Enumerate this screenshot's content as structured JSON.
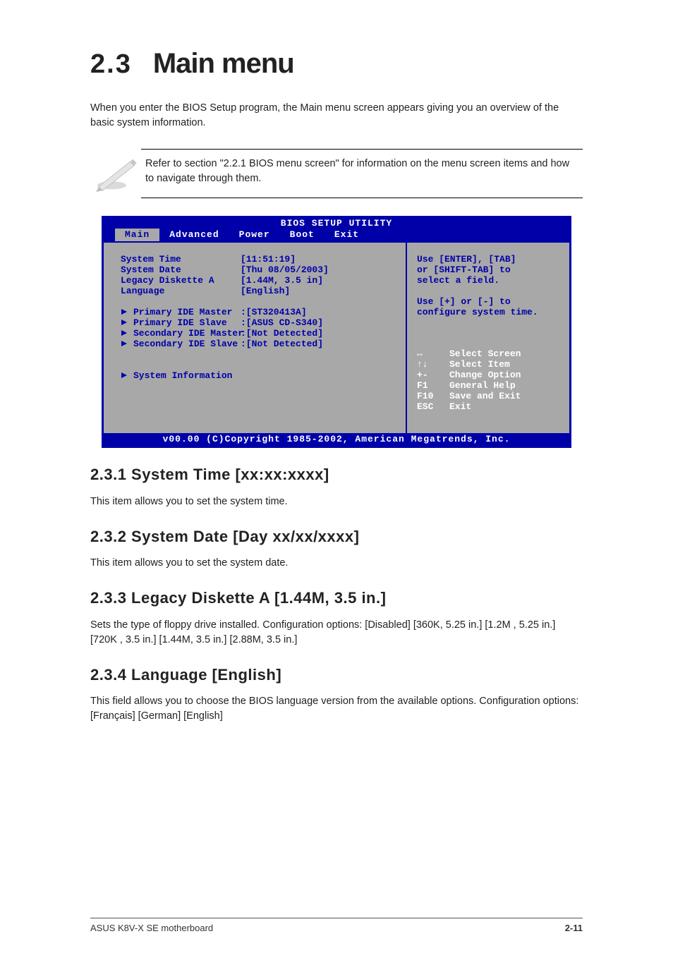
{
  "heading": {
    "number": "2.3",
    "title": "Main menu"
  },
  "intro_text": "When you enter the BIOS Setup program, the Main menu screen appears giving you an overview of the basic system information.",
  "note_text": "Refer to section \"2.2.1 BIOS menu screen\" for information on the menu screen items and how to navigate through them.",
  "bios": {
    "title": "BIOS SETUP UTILITY",
    "menu_tabs": [
      "Main",
      "Advanced",
      "Power",
      "Boot",
      "Exit"
    ],
    "active_tab_index": 0,
    "group1": [
      {
        "label": "System Time",
        "value": "[11:51:19]"
      },
      {
        "label": "System Date",
        "value": "[Thu 08/05/2003]"
      },
      {
        "label": "Legacy Diskette A",
        "value": "[1.44M, 3.5 in]"
      },
      {
        "label": "Language",
        "value": "[English]"
      }
    ],
    "group2": [
      {
        "label": "Primary IDE Master",
        "value": ":[ST320413A]"
      },
      {
        "label": "Primary IDE Slave",
        "value": ":[ASUS CD-S340]"
      },
      {
        "label": "Secondary IDE Master",
        "value": ":[Not Detected]"
      },
      {
        "label": "Secondary IDE Slave",
        "value": ":[Not Detected]"
      }
    ],
    "group3": [
      {
        "label": "System Information",
        "value": ""
      }
    ],
    "help_top": "Use [ENTER], [TAB]\nor [SHIFT-TAB] to\nselect a field.\n\nUse [+] or [-] to\nconfigure system time.",
    "keys": [
      {
        "k": "↔",
        "d": "Select Screen"
      },
      {
        "k": "↑↓",
        "d": "Select Item"
      },
      {
        "k": "+-",
        "d": "Change Option"
      },
      {
        "k": "F1",
        "d": "General Help"
      },
      {
        "k": "F10",
        "d": "Save and Exit"
      },
      {
        "k": "ESC",
        "d": "Exit"
      }
    ],
    "footer": "v00.00 (C)Copyright 1985-2002, American Megatrends, Inc."
  },
  "sections": [
    {
      "heading": "2.3.1 System Time [xx:xx:xxxx]",
      "body": "This item allows you to set the system time."
    },
    {
      "heading": "2.3.2 System Date [Day xx/xx/xxxx]",
      "body": "This item allows you to set the system date."
    },
    {
      "heading": "2.3.3 Legacy Diskette A [1.44M, 3.5 in.]",
      "body": "Sets the type of floppy drive installed. Configuration options: [Disabled] [360K, 5.25 in.] [1.2M , 5.25 in.] [720K , 3.5 in.] [1.44M, 3.5 in.] [2.88M, 3.5 in.]"
    },
    {
      "heading": "2.3.4 Language [English]",
      "body": "This field allows you to choose the BIOS language version from the available options. Configuration options: [Français] [German] [English]"
    }
  ],
  "footer": {
    "left": "ASUS K8V-X SE motherboard",
    "right": "2-11"
  }
}
